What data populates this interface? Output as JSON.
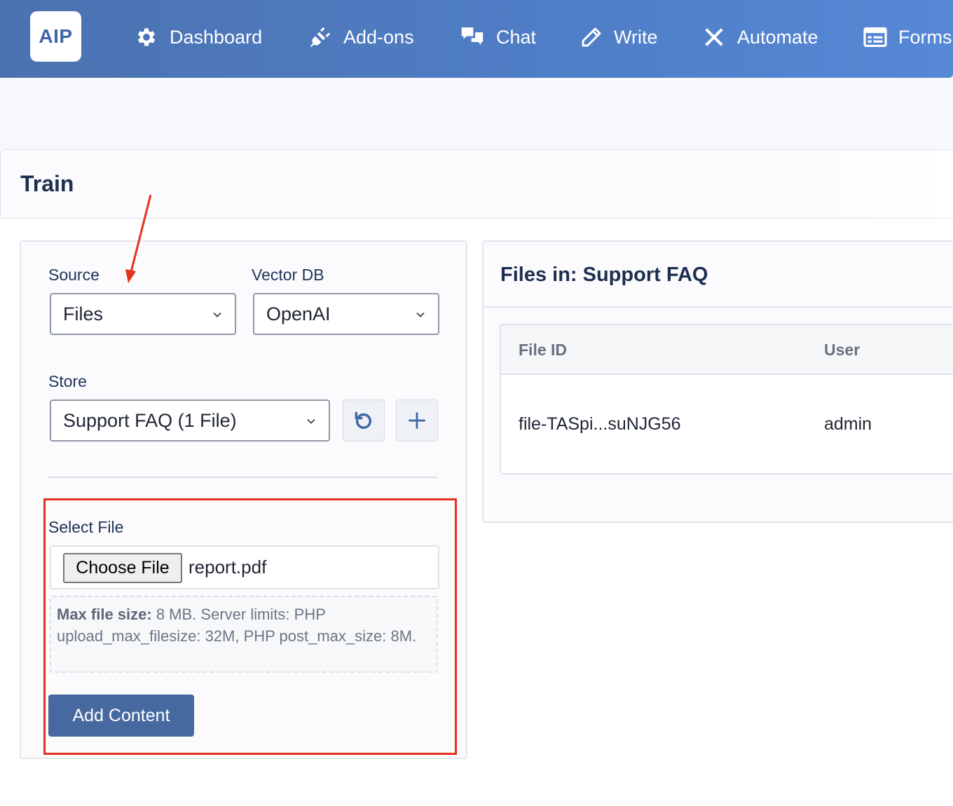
{
  "brand": {
    "logo_text": "AIP"
  },
  "nav": {
    "items": [
      {
        "label": "Dashboard",
        "icon": "gear-icon"
      },
      {
        "label": "Add-ons",
        "icon": "plug-icon"
      },
      {
        "label": "Chat",
        "icon": "chat-icon"
      },
      {
        "label": "Write",
        "icon": "pencil-icon"
      },
      {
        "label": "Automate",
        "icon": "tools-icon"
      },
      {
        "label": "Forms",
        "icon": "form-icon"
      }
    ]
  },
  "page": {
    "title": "Train"
  },
  "train_form": {
    "source_label": "Source",
    "source_value": "Files",
    "vector_db_label": "Vector DB",
    "vector_db_value": "OpenAI",
    "store_label": "Store",
    "store_value": "Support FAQ (1 File)",
    "select_file_label": "Select File",
    "choose_file_button": "Choose File",
    "chosen_file": "report.pdf",
    "hint_bold": "Max file size:",
    "hint_text": " 8 MB. Server limits: PHP upload_max_filesize: 32M, PHP post_max_size: 8M.",
    "add_button": "Add Content"
  },
  "files_panel": {
    "title": "Files in: Support FAQ",
    "columns": [
      "File ID",
      "User"
    ],
    "rows": [
      {
        "file_id": "file-TASpi...suNJG56",
        "user": "admin"
      }
    ]
  },
  "colors": {
    "nav_gradient_start": "#4b72b0",
    "nav_gradient_end": "#5688d6",
    "primary_button": "#46699f",
    "annotation_red": "#e5301f"
  }
}
